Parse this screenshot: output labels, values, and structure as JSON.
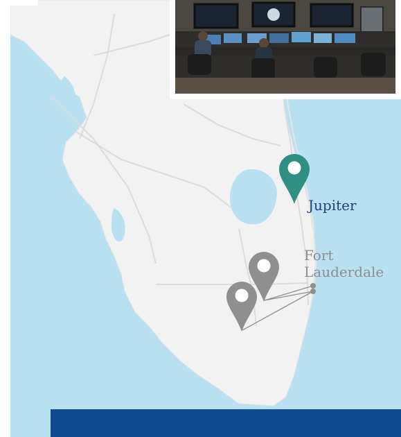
{
  "map": {
    "region": "South Florida",
    "water_color": "#b9e1f2",
    "land_color": "#f2f2f2",
    "accent_color": "#2f8f83",
    "secondary_marker_color": "#8f8f8f"
  },
  "photo": {
    "description_icon": "control-room-photo"
  },
  "locations": [
    {
      "label": "Jupiter",
      "marker": "teal-pin-icon"
    },
    {
      "label": "Fort\nLauderdale",
      "marker": "gray-pin-icon"
    }
  ],
  "footer_bar_color": "#0e4a8f"
}
